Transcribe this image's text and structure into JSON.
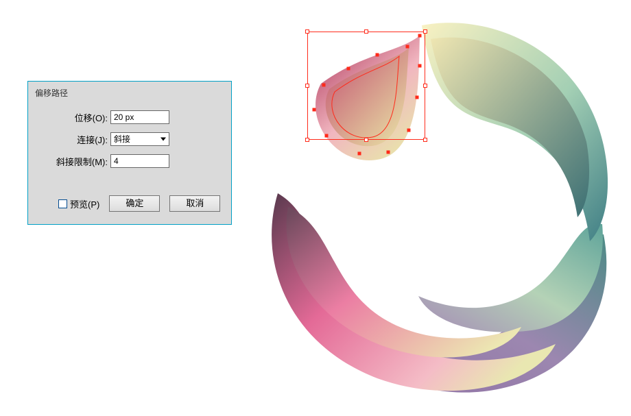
{
  "dialog": {
    "title": "偏移路径",
    "offset_label": "位移(O):",
    "offset_value": "20 px",
    "join_label": "连接(J):",
    "join_value": "斜接",
    "miter_label": "斜接限制(M):",
    "miter_value": "4",
    "preview_label": "预览(P)",
    "ok_label": "确定",
    "cancel_label": "取消"
  },
  "colors": {
    "dialog_border": "#00a0c6",
    "dialog_fill": "#dadada",
    "selection": "#ff2a1a"
  }
}
